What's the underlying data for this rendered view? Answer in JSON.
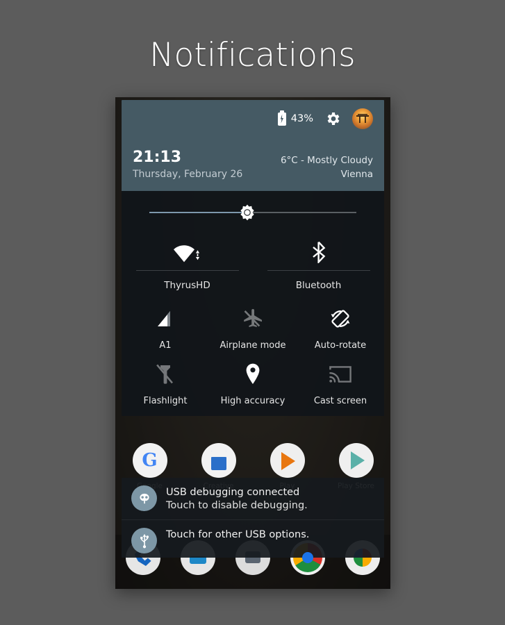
{
  "page": {
    "title": "Notifications"
  },
  "statusbar": {
    "battery_percent": "43%",
    "battery_icon": "battery-charging-icon",
    "settings_icon": "gear-icon",
    "avatar_icon": "user-avatar"
  },
  "header": {
    "clock": "21:13",
    "date": "Thursday, February 26",
    "weather_condition": "6°C - Mostly Cloudy",
    "weather_city": "Vienna",
    "background_color": "#455a64"
  },
  "brightness": {
    "name": "brightness-slider",
    "value_percent": 48,
    "icon": "brightness-sun-icon",
    "fill_color": "#7d98ad",
    "track_color": "#5a5f63"
  },
  "connectivity_tiles": [
    {
      "label": "ThyrusHD",
      "icon": "wifi-icon",
      "state": "on"
    },
    {
      "label": "Bluetooth",
      "icon": "bluetooth-icon",
      "state": "on"
    }
  ],
  "quick_tiles_row1": [
    {
      "label": "A1",
      "icon": "cell-signal-icon",
      "state": "on"
    },
    {
      "label": "Airplane mode",
      "icon": "airplane-off-icon",
      "state": "off"
    },
    {
      "label": "Auto-rotate",
      "icon": "auto-rotate-icon",
      "state": "on"
    }
  ],
  "quick_tiles_row2": [
    {
      "label": "Flashlight",
      "icon": "flashlight-off-icon",
      "state": "off"
    },
    {
      "label": "High accuracy",
      "icon": "location-pin-icon",
      "state": "on"
    },
    {
      "label": "Cast screen",
      "icon": "cast-screen-icon",
      "state": "off"
    }
  ],
  "notifications": [
    {
      "icon": "cyanogenmod-bug-icon",
      "title": "USB debugging connected",
      "subtitle": "Touch to disable debugging."
    },
    {
      "icon": "usb-icon",
      "title": "Touch for other USB options.",
      "subtitle": ""
    }
  ],
  "homescreen": {
    "apps_row": [
      {
        "label": "Google",
        "icon": "google-app-icon"
      },
      {
        "label": "Creative",
        "icon": "docs-app-icon"
      },
      {
        "label": "Play",
        "icon": "play-music-app-icon"
      },
      {
        "label": "Play Store",
        "icon": "play-store-app-icon"
      }
    ],
    "dock_row": [
      {
        "label": "",
        "icon": "phone-app-icon"
      },
      {
        "label": "",
        "icon": "messaging-app-icon"
      },
      {
        "label": "",
        "icon": "camera-app-icon"
      },
      {
        "label": "",
        "icon": "chrome-app-icon"
      },
      {
        "label": "",
        "icon": "photos-app-icon"
      }
    ]
  },
  "colors": {
    "page_background": "#5c5c5c",
    "panel_background": "#14181c",
    "header_accent": "#455a64"
  }
}
